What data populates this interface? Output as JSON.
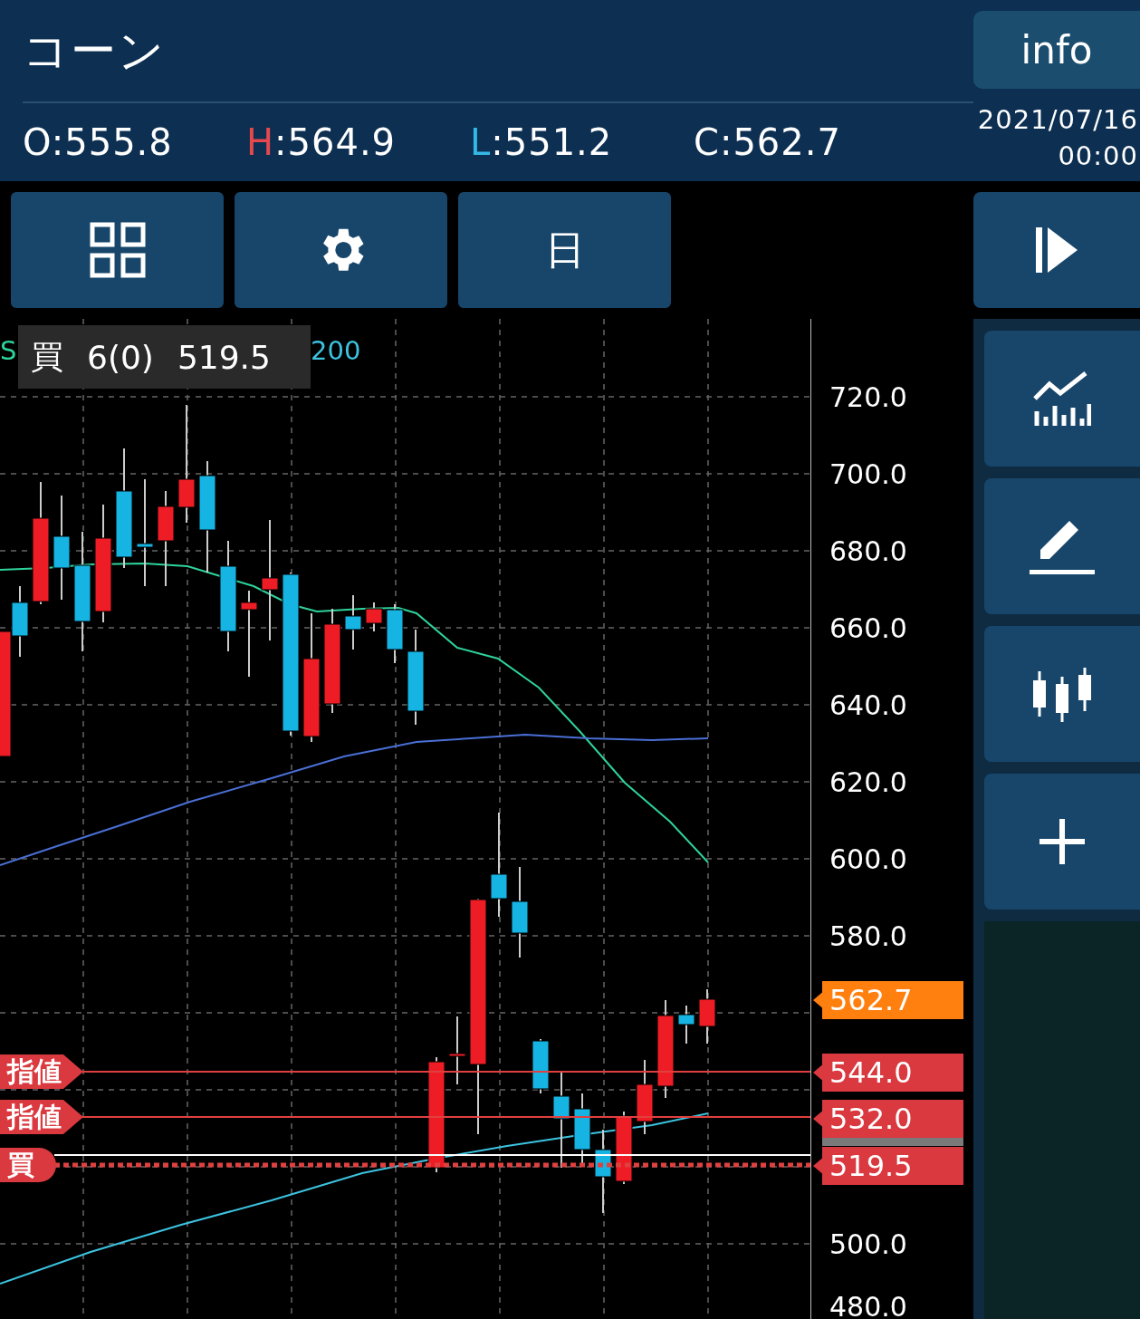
{
  "header": {
    "title": "コーン",
    "info_button": "info",
    "date": "2021/07/16",
    "time": "00:00"
  },
  "ohlc": [
    {
      "letter": "O",
      "value": ":555.8",
      "color": "#ffffff"
    },
    {
      "letter": "H",
      "value": ":564.9",
      "color": "#e5484d"
    },
    {
      "letter": "L",
      "value": ":551.2",
      "color": "#35b8e6"
    },
    {
      "letter": "C",
      "value": ":562.7",
      "color": "#ffffff"
    }
  ],
  "toolbar": {
    "period_button": "日"
  },
  "legend": [
    {
      "label": "S",
      "color": "#2fd39a"
    },
    {
      "label": "200",
      "color": "#3cc3e0"
    }
  ],
  "sma_lines": [
    {
      "color": "#2fd39a"
    },
    {
      "color": "#4a6fd6"
    },
    {
      "color": "#3cc3e0"
    }
  ],
  "position_overlay": {
    "side": "買",
    "quantity": "6(0)",
    "price": "519.5"
  },
  "y_axis": {
    "ticks_upper": [
      "720.0",
      "700.0",
      "680.0",
      "660.0",
      "640.0",
      "620.0",
      "600.0",
      "580.0"
    ],
    "ticks_lower": [
      "500.0",
      "480.0"
    ]
  },
  "price_tags": [
    {
      "value": "562.7",
      "color": "#ff7f0f"
    },
    {
      "value": "544.0",
      "color": "#d9393f"
    },
    {
      "value": "532.0",
      "color": "#d9393f"
    },
    {
      "value": "519.5",
      "color": "#d9393f"
    }
  ],
  "order_labels": [
    {
      "label": "指値",
      "kind": "order"
    },
    {
      "label": "指値",
      "kind": "order"
    },
    {
      "label": "買",
      "kind": "position"
    }
  ]
}
